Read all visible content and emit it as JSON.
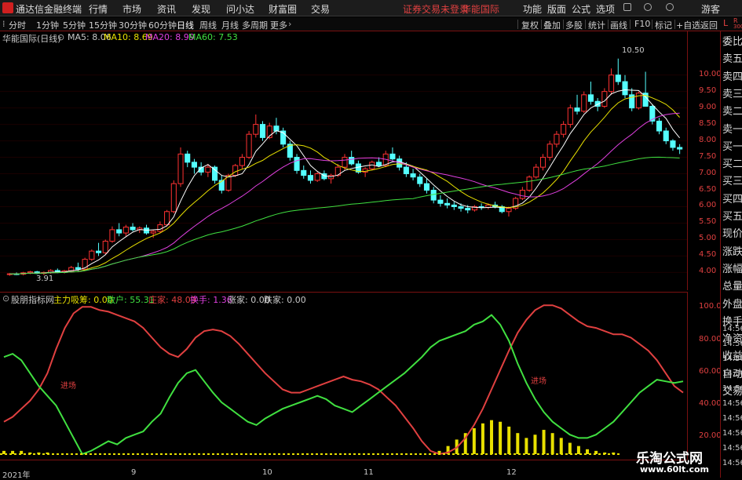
{
  "titlebar": {
    "app_name": "通达信金融终端",
    "menus": [
      "行情",
      "市场",
      "资讯",
      "发现",
      "问小达",
      "财富圈",
      "交易"
    ],
    "notice": "证券交易未登录",
    "stock_name_red": "华能国际",
    "right_menus": [
      "功能",
      "版面",
      "公式",
      "选项"
    ],
    "user": "游客"
  },
  "toolbar": {
    "periods": [
      "分时",
      "1分钟",
      "5分钟",
      "15分钟",
      "30分钟",
      "60分钟",
      "日线",
      "周线",
      "月线",
      "多周期",
      "更多"
    ],
    "active_period": "日线",
    "right_buttons": [
      "复权",
      "叠加",
      "多股",
      "统计",
      "画线",
      "F10",
      "标记",
      "+自选",
      "返回"
    ]
  },
  "chart_info": {
    "title": "华能国际(日线)",
    "ma_items": [
      {
        "label": "MA5: 8.06",
        "color": "#ffffff"
      },
      {
        "label": "MA10: 8.69",
        "color": "#e8e000"
      },
      {
        "label": "MA20: 8.99",
        "color": "#e040e0"
      },
      {
        "label": "MA60: 7.53",
        "color": "#40e040"
      }
    ]
  },
  "osc_info": {
    "title": "股朋指标网",
    "items": [
      {
        "label": "主力吸筹: 0.00",
        "color": "#e8e000"
      },
      {
        "label": "散户: 55.31",
        "color": "#40e040"
      },
      {
        "label": "庄家: 48.09",
        "color": "#e04040"
      },
      {
        "label": "换手: 1.36",
        "color": "#e040e0"
      },
      {
        "label": "涨家: 0.00",
        "color": "#c8c8c8"
      },
      {
        "label": "跌家: 0.00",
        "color": "#c8c8c8"
      }
    ],
    "annotations": [
      "进场",
      "进场"
    ]
  },
  "price_axis": [
    "10.00",
    "9.50",
    "9.00",
    "8.50",
    "8.00",
    "7.50",
    "7.00",
    "6.50",
    "6.00",
    "5.50",
    "5.00",
    "4.50",
    "4.00"
  ],
  "osc_axis": [
    "100.0",
    "80.00",
    "60.00",
    "40.00",
    "20.00"
  ],
  "price_marks": {
    "high": "10.50",
    "low": "3.91"
  },
  "x_axis": [
    "2021年",
    "9",
    "10",
    "11",
    "12"
  ],
  "side_panel": {
    "top": [
      "L",
      "R"
    ],
    "top_small": "300",
    "items": [
      "委比",
      "卖五",
      "卖四",
      "卖三",
      "卖二",
      "卖一",
      "买一",
      "买二",
      "买三",
      "买四",
      "买五",
      "现价",
      "涨跌",
      "涨幅",
      "总量",
      "外盘",
      "换手",
      "净资",
      "收益",
      "自动",
      "交易"
    ],
    "times": [
      "14:56",
      "14:56",
      "14:56",
      "14:56",
      "14:56",
      "14:56",
      "14:56",
      "14:56",
      "14:56",
      "14:56"
    ]
  },
  "watermark": {
    "line1": "乐淘公式网",
    "line2": "www.60lt.com"
  },
  "chart_data": {
    "type": "candlestick",
    "title": "华能国际(日线)",
    "ylim": [
      3.7,
      10.85
    ],
    "candles": [
      [
        3.95,
        3.98,
        3.9,
        3.96
      ],
      [
        3.96,
        4.0,
        3.92,
        3.95
      ],
      [
        3.95,
        4.02,
        3.91,
        3.99
      ],
      [
        3.99,
        4.05,
        3.95,
        4.02
      ],
      [
        4.02,
        4.05,
        3.95,
        3.97
      ],
      [
        3.97,
        4.03,
        3.92,
        4.0
      ],
      [
        4.0,
        4.1,
        3.96,
        4.06
      ],
      [
        4.06,
        4.12,
        3.98,
        4.01
      ],
      [
        4.01,
        4.08,
        3.97,
        4.05
      ],
      [
        4.05,
        4.2,
        4.0,
        4.15
      ],
      [
        4.15,
        4.3,
        4.05,
        4.1
      ],
      [
        4.1,
        4.45,
        4.08,
        4.4
      ],
      [
        4.4,
        4.7,
        4.35,
        4.65
      ],
      [
        4.65,
        4.9,
        4.5,
        4.6
      ],
      [
        4.6,
        5.0,
        4.55,
        4.95
      ],
      [
        4.95,
        5.4,
        4.9,
        5.3
      ],
      [
        5.3,
        5.5,
        5.1,
        5.2
      ],
      [
        5.2,
        5.45,
        5.1,
        5.38
      ],
      [
        5.38,
        5.5,
        5.25,
        5.3
      ],
      [
        5.3,
        5.4,
        5.2,
        5.35
      ],
      [
        5.35,
        5.45,
        5.15,
        5.2
      ],
      [
        5.2,
        5.3,
        5.05,
        5.25
      ],
      [
        5.25,
        5.55,
        5.2,
        5.45
      ],
      [
        5.45,
        5.9,
        5.4,
        5.85
      ],
      [
        5.85,
        6.8,
        5.8,
        6.7
      ],
      [
        6.7,
        7.8,
        6.6,
        7.6
      ],
      [
        7.6,
        7.7,
        7.2,
        7.35
      ],
      [
        7.35,
        7.45,
        7.0,
        7.2
      ],
      [
        7.2,
        7.35,
        6.95,
        7.05
      ],
      [
        7.05,
        7.3,
        6.9,
        7.2
      ],
      [
        7.2,
        7.25,
        6.7,
        6.8
      ],
      [
        6.8,
        6.95,
        6.4,
        6.5
      ],
      [
        6.5,
        7.0,
        6.45,
        6.95
      ],
      [
        6.95,
        7.3,
        6.9,
        7.25
      ],
      [
        7.25,
        7.6,
        7.15,
        7.5
      ],
      [
        7.5,
        8.3,
        7.45,
        8.2
      ],
      [
        8.2,
        8.8,
        8.1,
        8.5
      ],
      [
        8.5,
        8.6,
        8.0,
        8.1
      ],
      [
        8.1,
        8.55,
        8.05,
        8.45
      ],
      [
        8.45,
        8.7,
        8.2,
        8.3
      ],
      [
        8.3,
        8.4,
        7.8,
        7.9
      ],
      [
        7.9,
        8.0,
        7.4,
        7.5
      ],
      [
        7.5,
        7.6,
        7.0,
        7.1
      ],
      [
        7.1,
        7.25,
        6.85,
        6.95
      ],
      [
        6.95,
        7.1,
        6.7,
        6.8
      ],
      [
        6.8,
        7.05,
        6.75,
        7.0
      ],
      [
        7.0,
        7.1,
        6.8,
        6.85
      ],
      [
        6.85,
        7.0,
        6.7,
        6.95
      ],
      [
        6.95,
        7.3,
        6.9,
        7.2
      ],
      [
        7.2,
        7.6,
        7.1,
        7.5
      ],
      [
        7.5,
        7.7,
        7.25,
        7.3
      ],
      [
        7.3,
        7.4,
        7.0,
        7.05
      ],
      [
        7.05,
        7.2,
        6.9,
        7.15
      ],
      [
        7.15,
        7.4,
        7.1,
        7.35
      ],
      [
        7.35,
        7.5,
        7.2,
        7.25
      ],
      [
        7.25,
        7.7,
        7.2,
        7.6
      ],
      [
        7.6,
        7.8,
        7.4,
        7.45
      ],
      [
        7.45,
        7.55,
        7.1,
        7.2
      ],
      [
        7.2,
        7.35,
        6.9,
        7.0
      ],
      [
        7.0,
        7.15,
        6.8,
        6.9
      ],
      [
        6.9,
        7.0,
        6.6,
        6.7
      ],
      [
        6.7,
        6.85,
        6.4,
        6.5
      ],
      [
        6.5,
        6.6,
        6.1,
        6.2
      ],
      [
        6.2,
        6.35,
        6.0,
        6.1
      ],
      [
        6.1,
        6.25,
        5.95,
        6.05
      ],
      [
        6.05,
        6.15,
        5.9,
        6.0
      ],
      [
        6.0,
        6.1,
        5.85,
        5.95
      ],
      [
        5.95,
        6.05,
        5.8,
        5.9
      ],
      [
        5.9,
        6.05,
        5.85,
        6.0
      ],
      [
        6.0,
        6.1,
        5.9,
        5.98
      ],
      [
        5.98,
        6.1,
        5.92,
        6.05
      ],
      [
        6.05,
        6.15,
        5.95,
        6.0
      ],
      [
        6.0,
        6.05,
        5.8,
        5.85
      ],
      [
        5.85,
        6.0,
        5.7,
        5.95
      ],
      [
        5.95,
        6.3,
        5.9,
        6.25
      ],
      [
        6.25,
        6.6,
        6.2,
        6.5
      ],
      [
        6.5,
        6.95,
        6.45,
        6.9
      ],
      [
        6.9,
        7.3,
        6.85,
        7.2
      ],
      [
        7.2,
        7.6,
        7.1,
        7.5
      ],
      [
        7.5,
        8.0,
        7.4,
        7.9
      ],
      [
        7.9,
        8.3,
        7.8,
        8.2
      ],
      [
        8.2,
        8.6,
        8.1,
        8.5
      ],
      [
        8.5,
        9.1,
        8.4,
        9.0
      ],
      [
        9.0,
        9.4,
        8.8,
        8.9
      ],
      [
        8.9,
        9.5,
        8.85,
        9.4
      ],
      [
        9.4,
        9.8,
        9.1,
        9.2
      ],
      [
        9.2,
        9.3,
        8.9,
        9.05
      ],
      [
        9.05,
        9.6,
        9.0,
        9.5
      ],
      [
        9.5,
        10.2,
        9.4,
        10.0
      ],
      [
        10.0,
        10.5,
        9.7,
        9.8
      ],
      [
        9.8,
        10.0,
        9.3,
        9.4
      ],
      [
        9.4,
        9.6,
        8.9,
        9.0
      ],
      [
        9.0,
        9.5,
        8.95,
        9.45
      ],
      [
        9.45,
        10.1,
        9.4,
        9.05
      ],
      [
        9.05,
        9.1,
        8.5,
        8.6
      ],
      [
        8.6,
        8.7,
        8.2,
        8.3
      ],
      [
        8.3,
        8.4,
        7.9,
        8.0
      ],
      [
        8.0,
        8.05,
        7.7,
        7.8
      ],
      [
        7.8,
        7.9,
        7.6,
        7.75
      ]
    ],
    "ma_lines": [
      {
        "name": "MA5",
        "color": "#ffffff"
      },
      {
        "name": "MA10",
        "color": "#e8e000"
      },
      {
        "name": "MA20",
        "color": "#e040e0"
      },
      {
        "name": "MA60",
        "color": "#40e040"
      }
    ],
    "oscillator": {
      "ylim": [
        10,
        105
      ],
      "series": [
        {
          "name": "庄家",
          "color": "#e04040",
          "values": [
            30,
            33,
            38,
            43,
            50,
            60,
            75,
            88,
            97,
            101,
            101,
            99,
            98,
            96,
            94,
            92,
            88,
            82,
            76,
            72,
            70,
            75,
            82,
            86,
            87,
            86,
            83,
            78,
            72,
            66,
            60,
            55,
            50,
            48,
            48,
            50,
            52,
            54,
            56,
            58,
            56,
            55,
            53,
            50,
            45,
            40,
            33,
            26,
            18,
            12,
            10,
            11,
            14,
            20,
            28,
            38,
            50,
            62,
            74,
            85,
            93,
            99,
            102,
            102,
            100,
            96,
            92,
            89,
            88,
            86,
            84,
            84,
            82,
            78,
            74,
            68,
            60,
            52,
            48
          ]
        },
        {
          "name": "散户",
          "color": "#40e040",
          "values": [
            70,
            72,
            68,
            60,
            52,
            46,
            40,
            30,
            20,
            10,
            12,
            15,
            18,
            16,
            20,
            22,
            24,
            30,
            35,
            45,
            54,
            60,
            62,
            55,
            48,
            42,
            38,
            34,
            30,
            28,
            32,
            35,
            38,
            40,
            42,
            44,
            46,
            44,
            40,
            38,
            36,
            40,
            44,
            48,
            52,
            56,
            60,
            65,
            70,
            76,
            80,
            82,
            84,
            86,
            90,
            92,
            96,
            90,
            80,
            66,
            54,
            44,
            36,
            30,
            26,
            22,
            20,
            20,
            22,
            26,
            30,
            36,
            42,
            48,
            52,
            56,
            55,
            54,
            55
          ]
        },
        {
          "name": "主力吸筹",
          "color": "#e8e000",
          "values": [
            2,
            2,
            2,
            1,
            1,
            1,
            0,
            0,
            0,
            0,
            0,
            0,
            0,
            0,
            0,
            0,
            0,
            0,
            0,
            0,
            0,
            0,
            0,
            0,
            0,
            0,
            0,
            0,
            0,
            0,
            0,
            0,
            0,
            0,
            0,
            0,
            0,
            0,
            0,
            0,
            0,
            0,
            0,
            0,
            0,
            0,
            0,
            0,
            0,
            0,
            2,
            5,
            9,
            13,
            16,
            19,
            21,
            20,
            17,
            13,
            10,
            12,
            15,
            13,
            10,
            7,
            5,
            3,
            2,
            1,
            1,
            0,
            0,
            0,
            0,
            0,
            0,
            0,
            0
          ]
        }
      ]
    }
  }
}
